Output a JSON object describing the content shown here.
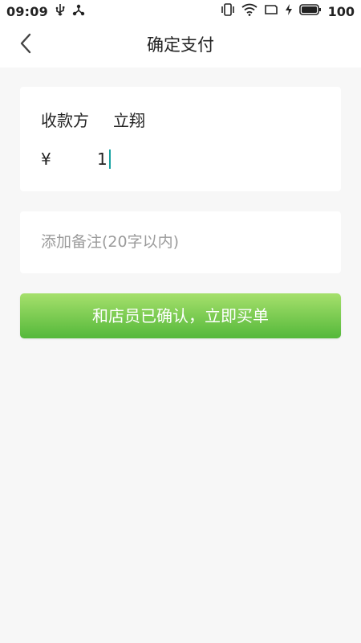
{
  "status_bar": {
    "time": "09:09",
    "battery_level": "100",
    "left_icons": [
      "usb-icon",
      "share-network-icon"
    ],
    "right_icons": [
      "vibrate-icon",
      "wifi-icon",
      "screen-rotate-icon",
      "charging-icon",
      "battery-icon"
    ]
  },
  "header": {
    "title": "确定支付",
    "back_icon": "chevron-left-icon"
  },
  "payee": {
    "label": "收款方",
    "name": "立翔"
  },
  "amount": {
    "currency_symbol": "¥",
    "value": "1"
  },
  "note": {
    "placeholder": "添加备注(20字以内)"
  },
  "confirm_button": {
    "label": "和店员已确认，立即买单",
    "gradient_start": "#a6e06c",
    "gradient_end": "#54b83a"
  },
  "colors": {
    "background": "#f7f7f7",
    "caret": "#19a3a3"
  }
}
